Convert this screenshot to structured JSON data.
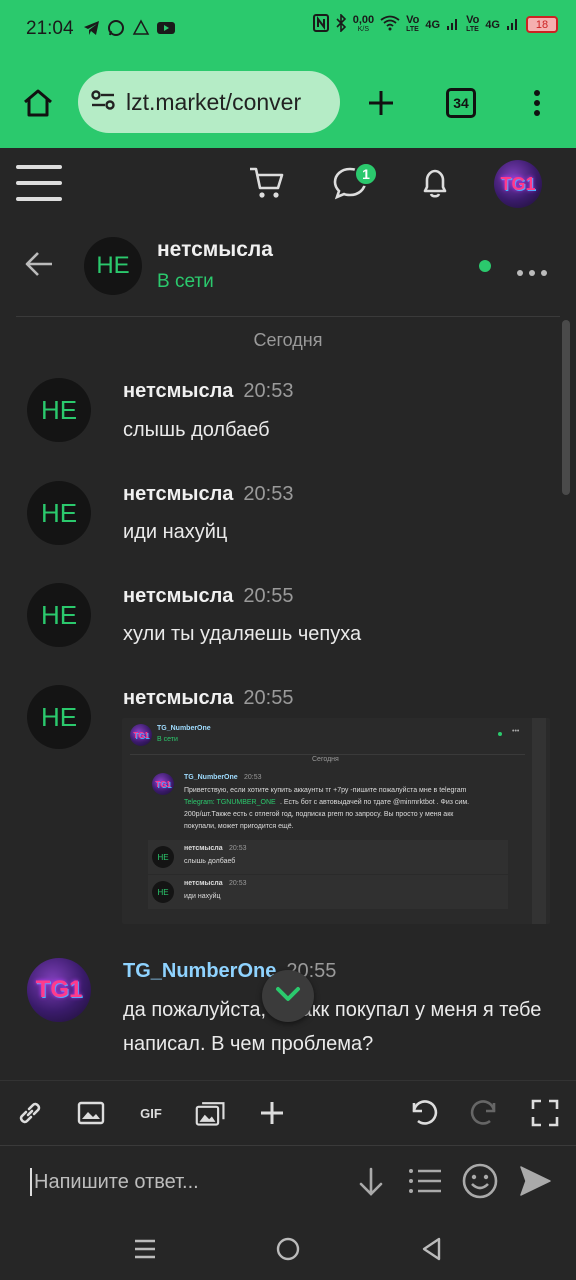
{
  "status_bar": {
    "time": "21:04",
    "speed": "0,00",
    "speed_unit": "K/S",
    "battery": "18",
    "net1": "Vo",
    "net1b": "LTE",
    "net2": "4G",
    "net3": "Vo",
    "net3b": "LTE",
    "net4": "4G"
  },
  "browser": {
    "url": "lzt.market/conver",
    "tab_count": "34"
  },
  "header": {
    "notifications_badge": "1",
    "user_avatar_text": "TG1"
  },
  "conversation": {
    "avatar_text": "НЕ",
    "name": "нетсмысла",
    "status": "В сети"
  },
  "date_separator": "Сегодня",
  "messages": [
    {
      "avatar": "НЕ",
      "author": "нетсмысла",
      "time": "20:53",
      "text": "слышь долбаеб"
    },
    {
      "avatar": "НЕ",
      "author": "нетсмысла",
      "time": "20:53",
      "text": "иди нахуйц"
    },
    {
      "avatar": "НЕ",
      "author": "нетсмысла",
      "time": "20:55",
      "text": "хули ты удаляешь чепуха"
    },
    {
      "avatar": "НЕ",
      "author": "нетсмысла",
      "time": "20:55",
      "text": ""
    },
    {
      "avatar": "TG1",
      "author": "TG_NumberOne",
      "time": "20:55",
      "text": "да пожалуйста, ты акк покупал у меня я тебе написал. В чем проблема?"
    }
  ],
  "embedded_screenshot": {
    "chat_name": "TG_NumberOne",
    "chat_status": "В сети",
    "date": "Сегодня",
    "msg1_author": "TG_NumberOne",
    "msg1_time": "20:53",
    "msg1_line1": "Приветствую, если хотите купить аккаунты тг +7ру -пишите пожалуйста мне в telegram",
    "msg1_line2a": "Telegram: TGNUMBER_ONE",
    "msg1_line2b": ". Есть бот с автовыдачей по тдате @minmrktbot . Физ сим.",
    "msg1_line3": "200р/шт.Также есть с отлегой год, подписка prem по запросу. Вы просто у меня акк",
    "msg1_line4": "покупали, может пригодится ещё.",
    "msg2_author": "нетсмысла",
    "msg2_time": "20:53",
    "msg2_text": "слышь долбаеб",
    "msg3_author": "нетсмысла",
    "msg3_time": "20:53",
    "msg3_text": "иди нахуйц",
    "avatar_ne": "НЕ",
    "avatar_tg": "TG1"
  },
  "composer": {
    "placeholder": "Напишите ответ...",
    "gif_label": "GIF"
  },
  "colors": {
    "accent": "#2bc96d",
    "background": "#262626",
    "link_blue": "#8fd3ff"
  }
}
